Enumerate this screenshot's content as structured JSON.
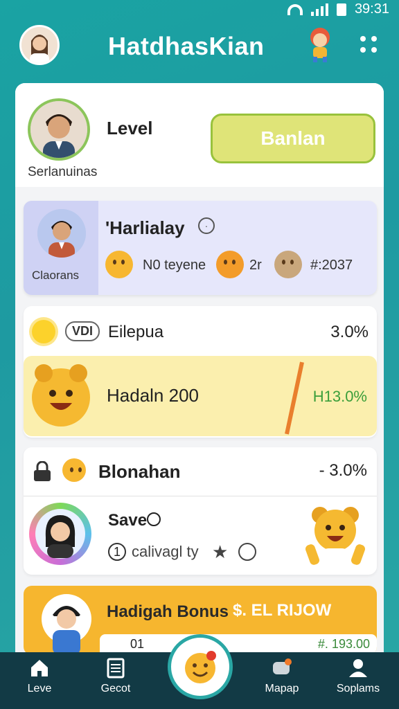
{
  "status_bar": {
    "time": "39:31"
  },
  "app": {
    "title": "HatdhasKian"
  },
  "profile": {
    "name": "Serlanuinas",
    "level_label": "Level",
    "cta_label": "Banlan"
  },
  "rank_card": {
    "side_label": "Claorans",
    "title": "'Harlialay",
    "items": [
      {
        "icon": "smiley-icon",
        "text": "N0 teyene"
      },
      {
        "icon": "bear-icon",
        "text": "2r"
      },
      {
        "icon": "animal-icon",
        "text": "#:2037"
      }
    ]
  },
  "list_card": {
    "badge": "VDI",
    "title": "Eilepua",
    "percent": "3.0%",
    "highlight": {
      "title": "Hadaln 200",
      "value": "H13.0%"
    }
  },
  "blonghan_card": {
    "title": "Blonahan",
    "percent": "- 3.0%",
    "entry": {
      "title": "Save",
      "subtitle": "calivagl ty",
      "prefix": "1"
    }
  },
  "bonus_card": {
    "title": "Hadigah Bonus",
    "tag": "$. EL RIJOW",
    "value_left": "01",
    "value_right": "#. 193.00"
  },
  "bottom_nav": {
    "items": [
      {
        "label": "Leve"
      },
      {
        "label": "Gecot"
      },
      {
        "label": "Mapap"
      },
      {
        "label": "Soplams"
      }
    ]
  },
  "colors": {
    "primary": "#1aa3a3",
    "nav": "#123a45",
    "cta": "#dfe478",
    "bonus": "#f6b62f",
    "highlight": "#fbefae"
  }
}
